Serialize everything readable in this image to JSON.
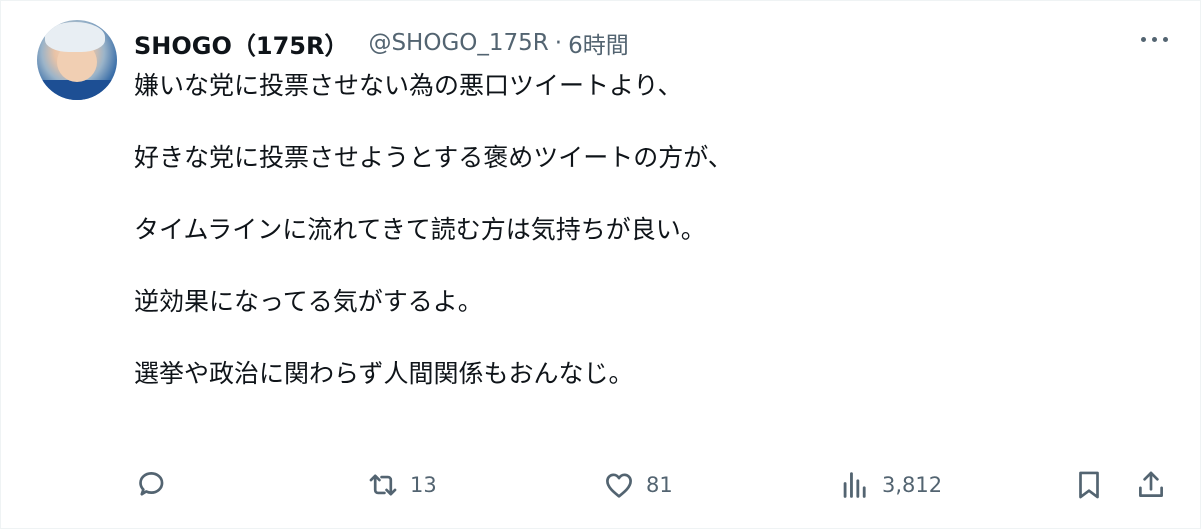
{
  "author": {
    "name": "SHOGO（175R）",
    "handle": "@SHOGO_175R",
    "separator": "·",
    "time": "6時間"
  },
  "tweet": {
    "lines": [
      "嫌いな党に投票させない為の悪口ツイートより、",
      "好きな党に投票させようとする褒めツイートの方が、",
      "タイムラインに流れてきて読む方は気持ちが良い。",
      "逆効果になってる気がするよ。",
      "選挙や政治に関わらず人間関係もおんなじ。"
    ]
  },
  "actions": {
    "reply": {
      "icon": "reply-icon",
      "count": ""
    },
    "retweet": {
      "icon": "retweet-icon",
      "count": "13"
    },
    "like": {
      "icon": "heart-icon",
      "count": "81"
    },
    "views": {
      "icon": "views-icon",
      "count": "3,812"
    },
    "bookmark": {
      "icon": "bookmark-icon"
    },
    "share": {
      "icon": "share-icon"
    }
  },
  "colors": {
    "text": "#0f1419",
    "secondary": "#536471",
    "border": "#eff3f4"
  }
}
